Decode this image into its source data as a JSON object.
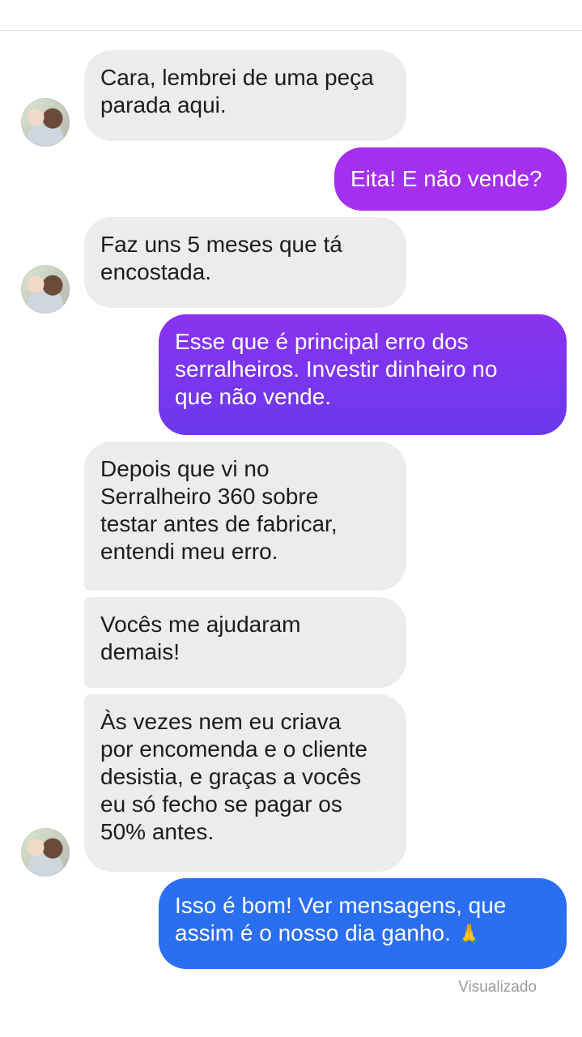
{
  "messages": [
    {
      "from": "them",
      "lines": [
        "Cara, lembrei de uma peça",
        "parada aqui."
      ]
    },
    {
      "from": "me",
      "lines": [
        "Eita! E não vende?"
      ]
    },
    {
      "from": "them",
      "lines": [
        "Faz uns 5 meses que tá",
        "encostada."
      ]
    },
    {
      "from": "me",
      "lines": [
        "Esse que é principal erro dos",
        "serralheiros. Investir dinheiro no",
        "que não vende."
      ]
    },
    {
      "from": "them",
      "lines": [
        "Depois que vi no",
        "Serralheiro 360 sobre",
        "testar antes de fabricar,",
        "entendi meu erro."
      ]
    },
    {
      "from": "them",
      "lines": [
        "Vocês me ajudaram",
        "demais!"
      ]
    },
    {
      "from": "them",
      "lines": [
        "Às vezes nem eu criava",
        "por encomenda e o cliente",
        "desistia, e graças a vocês",
        "eu só fecho se pagar os",
        "50% antes."
      ]
    },
    {
      "from": "me",
      "lines": [
        "Isso é bom! Ver mensagens, que",
        "assim é o nosso dia ganho."
      ],
      "emoji": "🙏"
    }
  ],
  "status": "Visualizado",
  "colors": {
    "incoming_bg": "#ececec",
    "outgoing_purple_top": "#a42ff0",
    "outgoing_violet": "#7a35ee",
    "outgoing_blue": "#2d6ff0"
  }
}
